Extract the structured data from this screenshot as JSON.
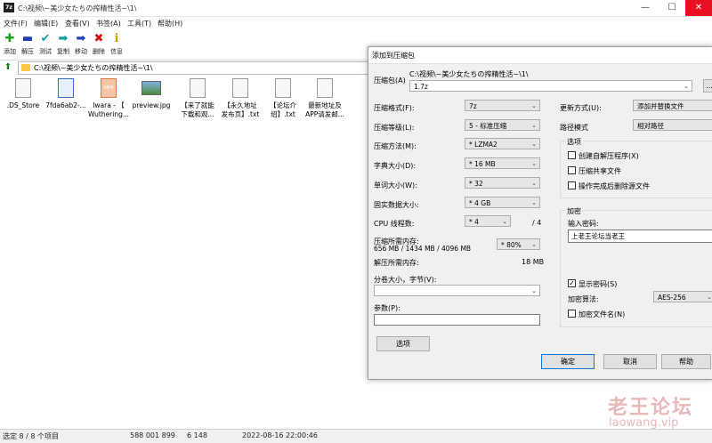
{
  "window": {
    "title": "C:\\视频\\~美少女たちの搾精性活~\\1\\",
    "app_icon": "7z"
  },
  "window_controls": {
    "minimize": "—",
    "maximize": "☐",
    "close": "✕"
  },
  "menu": [
    "文件(F)",
    "编辑(E)",
    "查看(V)",
    "书签(A)",
    "工具(T)",
    "帮助(H)"
  ],
  "toolbar": [
    {
      "label": "添加",
      "icon": "add-icon",
      "glyph": "✚",
      "color": "#16a316"
    },
    {
      "label": "解压",
      "icon": "extract-icon",
      "glyph": "▬",
      "color": "#1d3fb8"
    },
    {
      "label": "测试",
      "icon": "test-icon",
      "glyph": "✔",
      "color": "#16a0a0"
    },
    {
      "label": "复制",
      "icon": "copy-icon",
      "glyph": "➡",
      "color": "#16a0a0"
    },
    {
      "label": "移动",
      "icon": "move-icon",
      "glyph": "➡",
      "color": "#1d3fb8"
    },
    {
      "label": "删除",
      "icon": "delete-icon",
      "glyph": "✖",
      "color": "#d01616"
    },
    {
      "label": "信息",
      "icon": "info-icon",
      "glyph": "ℹ",
      "color": "#caa000"
    }
  ],
  "address": {
    "path": "C:\\视频\\~美少女たちの搾精性活~\\1\\"
  },
  "files": [
    {
      "line1": ".DS_Store",
      "line2": "",
      "type": "file"
    },
    {
      "line1": "7fda6ab2-...",
      "line2": "",
      "type": "image"
    },
    {
      "line1": "Iwara - 【",
      "line2": "Wuthering...",
      "type": "mp4"
    },
    {
      "line1": "preview.jpg",
      "line2": "",
      "type": "jpg"
    },
    {
      "line1": "【来了就能",
      "line2": "下载和观...",
      "type": "file"
    },
    {
      "line1": "【永久地址",
      "line2": "发布页】.txt",
      "type": "file"
    },
    {
      "line1": "【论坛介",
      "line2": "绍】.txt",
      "type": "file"
    },
    {
      "line1": "最新地址及",
      "line2": "APP请发邮...",
      "type": "file"
    }
  ],
  "status": {
    "selection": "选定 8 / 8 个项目",
    "size": "588 001 899",
    "packed": "6 148",
    "modified": "2022-08-16 22:00:46"
  },
  "dialog": {
    "title": "添加到压缩包",
    "archive_label": "压缩包(A)",
    "archive_dir": "C:\\视频\\~美少女たちの搾精性活~\\1\\",
    "archive_name": "1.7z",
    "browse": "...",
    "format_label": "压缩格式(F):",
    "format_value": "7z",
    "level_label": "压缩等级(L):",
    "level_value": "5 - 标准压缩",
    "method_label": "压缩方法(M):",
    "method_value": "* LZMA2",
    "dict_label": "字典大小(D):",
    "dict_value": "* 16 MB",
    "word_label": "单词大小(W):",
    "word_value": "* 32",
    "solid_label": "固实数据大小:",
    "solid_value": "* 4 GB",
    "cpu_label": "CPU 线程数:",
    "cpu_value": "* 4",
    "cpu_total": "/ 4",
    "mem_comp_label": "压缩所需内存:",
    "mem_comp_detail": "656 MB / 1434 MB / 4096 MB",
    "mem_percent": "* 80%",
    "mem_decomp_label": "解压所需内存:",
    "mem_decomp_value": "18 MB",
    "split_label": "分卷大小，字节(V):",
    "params_label": "参数(P):",
    "options_button": "选项",
    "update_label": "更新方式(U):",
    "update_value": "添加并替换文件",
    "pathmode_label": "路径模式",
    "pathmode_value": "相对路径",
    "options_group": "选项",
    "opt_sfx": "创建自解压程序(X)",
    "opt_shared": "压缩共享文件",
    "opt_delete": "操作完成后删除源文件",
    "encrypt_group": "加密",
    "password_label": "输入密码:",
    "password_value": "上老王论坛当老王",
    "show_password": "显示密码(S)",
    "enc_method_label": "加密算法:",
    "enc_method_value": "AES-256",
    "encrypt_names": "加密文件名(N)",
    "ok": "确定",
    "cancel": "取消",
    "help": "帮助"
  },
  "watermark": {
    "text": "老王论坛",
    "url": "laowang.vip"
  }
}
